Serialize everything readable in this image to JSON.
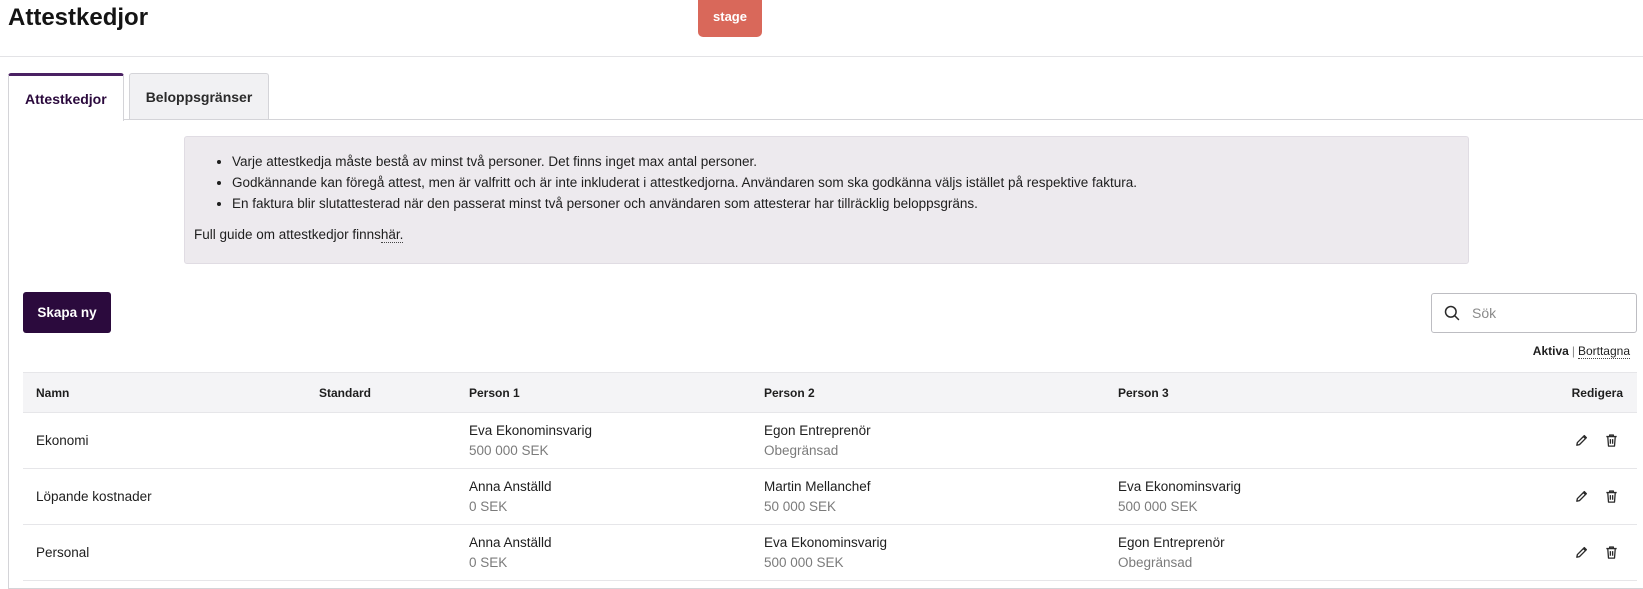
{
  "header": {
    "title": "Attestkedjor",
    "env_badge": "stage"
  },
  "tabs": [
    {
      "label": "Attestkedjor",
      "active": true
    },
    {
      "label": "Beloppsgränser",
      "active": false
    }
  ],
  "info": {
    "bullets": [
      "Varje attestkedja måste bestå av minst två personer. Det finns inget max antal personer.",
      "Godkännande kan föregå attest, men är valfritt och är inte inkluderat i attestkedjorna. Användaren som ska godkänna väljs istället på respektive faktura.",
      "En faktura blir slutattesterad när den passerat minst två personer och användaren som attesterar har tillräcklig beloppsgräns."
    ],
    "guide_text": "Full guide om attestkedjor finns",
    "guide_link": "här."
  },
  "actions": {
    "create_label": "Skapa ny",
    "search_placeholder": "Sök"
  },
  "filters": {
    "active_label": "Aktiva",
    "separator": "|",
    "deleted_label": "Borttagna"
  },
  "table": {
    "headers": {
      "name": "Namn",
      "standard": "Standard",
      "person1": "Person 1",
      "person2": "Person 2",
      "person3": "Person 3",
      "edit": "Redigera"
    },
    "rows": [
      {
        "name": "Ekonomi",
        "standard": "",
        "p1_name": "Eva Ekonominsvarig",
        "p1_limit": "500 000 SEK",
        "p2_name": "Egon Entreprenör",
        "p2_limit": "Obegränsad",
        "p3_name": "",
        "p3_limit": ""
      },
      {
        "name": "Löpande kostnader",
        "standard": "",
        "p1_name": "Anna Anställd",
        "p1_limit": "0 SEK",
        "p2_name": "Martin Mellanchef",
        "p2_limit": "50 000 SEK",
        "p3_name": "Eva Ekonominsvarig",
        "p3_limit": "500 000 SEK"
      },
      {
        "name": "Personal",
        "standard": "",
        "p1_name": "Anna Anställd",
        "p1_limit": "0 SEK",
        "p2_name": "Eva Ekonominsvarig",
        "p2_limit": "500 000 SEK",
        "p3_name": "Egon Entreprenör",
        "p3_limit": "Obegränsad"
      }
    ]
  },
  "icons": {
    "search": "search-icon",
    "edit": "pencil-icon",
    "delete": "trash-icon"
  },
  "colors": {
    "brand": "#2b0a3d",
    "tab_accent": "#4a2163",
    "env_badge": "#d9685a",
    "info_bg": "#edeaee"
  }
}
